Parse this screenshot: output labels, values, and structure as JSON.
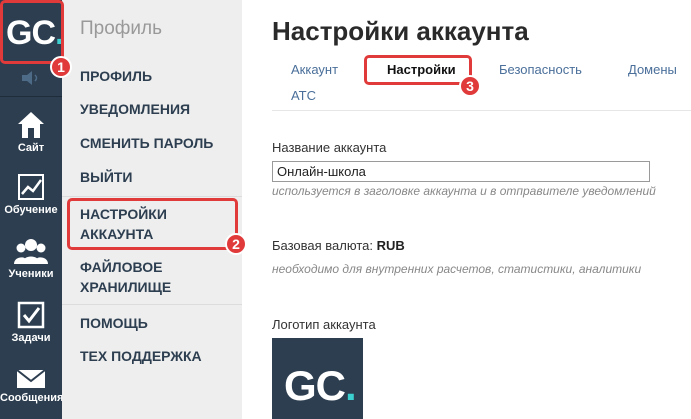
{
  "brand": {
    "logo_letters": "GC",
    "logo_g": "G",
    "logo_c": "C",
    "logo_dot": "."
  },
  "rail": {
    "items": [
      {
        "label": "Сайт",
        "icon": "home-icon"
      },
      {
        "label": "Обучение",
        "icon": "chart-icon"
      },
      {
        "label": "Ученики",
        "icon": "users-icon"
      },
      {
        "label": "Задачи",
        "icon": "checkbox-icon"
      },
      {
        "label": "Сообщения",
        "icon": "envelope-icon"
      }
    ]
  },
  "profile_menu": {
    "title": "Профиль",
    "items": [
      "ПРОФИЛЬ",
      "УВЕДОМЛЕНИЯ",
      "СМЕНИТЬ ПАРОЛЬ",
      "ВЫЙТИ",
      "НАСТРОЙКИ\nАККАУНТА",
      "ФАЙЛОВОЕ\nХРАНИЛИЩЕ",
      "ПОМОЩЬ",
      "ТЕХ ПОДДЕРЖКА"
    ],
    "item_1": "ПРОФИЛЬ",
    "item_2": "УВЕДОМЛЕНИЯ",
    "item_3": "СМЕНИТЬ ПАРОЛЬ",
    "item_4": "ВЫЙТИ",
    "item_5a": "НАСТРОЙКИ",
    "item_5b": "АККАУНТА",
    "item_6a": "ФАЙЛОВОЕ",
    "item_6b": "ХРАНИЛИЩЕ",
    "item_7": "ПОМОЩЬ",
    "item_8": "ТЕХ ПОДДЕРЖКА"
  },
  "main": {
    "title": "Настройки аккаунта",
    "tabs": [
      {
        "label": "Аккаунт",
        "active": false
      },
      {
        "label": "Настройки",
        "active": true
      },
      {
        "label": "Безопасность",
        "active": false
      },
      {
        "label": "Домены",
        "active": false
      },
      {
        "label": "АТС",
        "active": false
      }
    ],
    "account_name_label": "Название аккаунта",
    "account_name_value": "Онлайн-школа",
    "account_name_hint": "используется в заголовке аккаунта и в отправителе уведомлений",
    "currency_label": "Базовая валюта:",
    "currency_value": "RUB",
    "currency_hint": "необходимо для внутренних расчетов, статистики, аналитики",
    "logo_label": "Логотип аккаунта"
  },
  "callouts": {
    "n1": "1",
    "n2": "2",
    "n3": "3"
  },
  "colors": {
    "rail": "#2c3e50",
    "callout": "#e03a3a",
    "logo_dot": "#3ccfcf",
    "tab_link": "#4a6f9a"
  }
}
